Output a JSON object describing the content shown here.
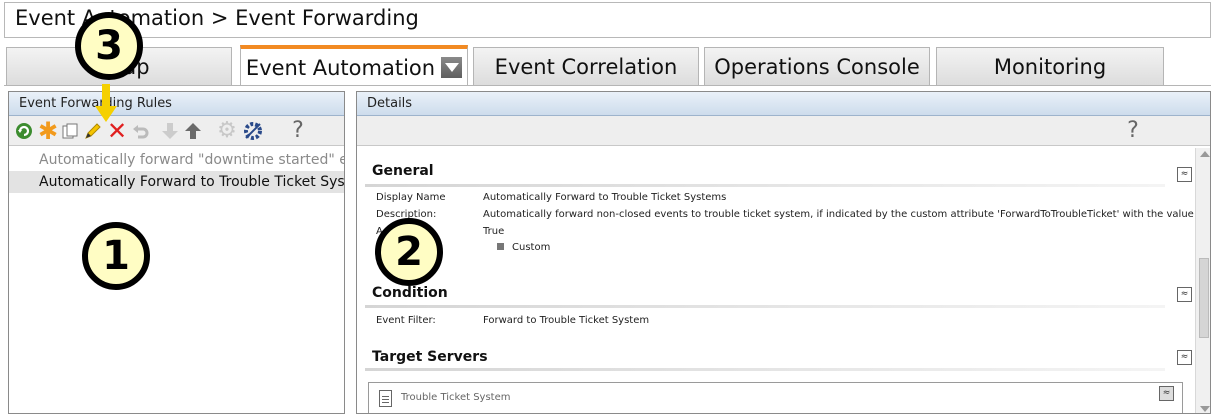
{
  "title": "Event Automation > Event Forwarding",
  "tabs": [
    {
      "label": "Setup"
    },
    {
      "label": "Event Automation"
    },
    {
      "label": "Event Correlation"
    },
    {
      "label": "Operations Console"
    },
    {
      "label": "Monitoring"
    }
  ],
  "left_panel": {
    "header": "Event Forwarding Rules",
    "toolbar_icons": [
      "refresh-icon",
      "new-icon",
      "copy-icon",
      "edit-icon",
      "delete-icon",
      "undo-icon",
      "move-down-icon",
      "move-up-icon",
      "settings-icon",
      "config-icon",
      "help-icon"
    ],
    "help_glyph": "?",
    "rules": [
      {
        "label": "Automatically forward \"downtime started\" eve..."
      },
      {
        "label": "Automatically Forward to Trouble Ticket Systems"
      }
    ]
  },
  "details": {
    "header": "Details",
    "help_glyph": "?",
    "general": {
      "title": "General",
      "display_name_label": "Display Name",
      "display_name": "Automatically Forward to Trouble Ticket Systems",
      "description_label": "Description:",
      "description": "Automatically forward non-closed events to trouble ticket system, if indicated by the custom attribute 'ForwardToTroubleTicket' with the value 'True'.",
      "active_label": "Active:",
      "active": "True",
      "custom": "Custom"
    },
    "condition": {
      "title": "Condition",
      "event_filter_label": "Event Filter:",
      "event_filter": "Forward to Trouble Ticket System"
    },
    "target_servers": {
      "title": "Target Servers",
      "item": "Trouble Ticket System"
    },
    "collapse_glyph": "≈"
  },
  "callouts": [
    "1",
    "2",
    "3"
  ],
  "colors": {
    "active_tab_accent": "#f28a22",
    "panel_header": "#cddcec",
    "callout_fill": "#fffdc4",
    "arrow": "#f5d000"
  }
}
